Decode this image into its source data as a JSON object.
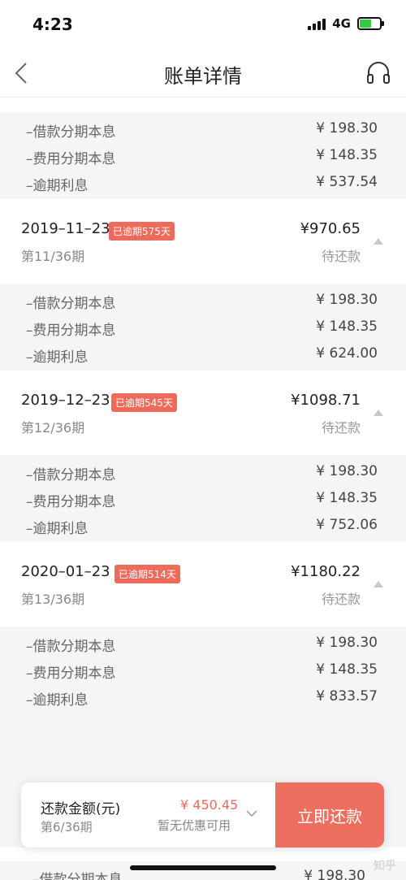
{
  "status_bar": {
    "time": "4:23",
    "network": "4G"
  },
  "nav": {
    "title": "账单详情",
    "back_icon": "chevron-left-icon",
    "service_icon": "headset-icon"
  },
  "first_details": [
    {
      "label": "–借款分期本息",
      "amount": "¥ 198.30"
    },
    {
      "label": "–费用分期本息",
      "amount": "¥ 148.35"
    },
    {
      "label": "–逾期利息",
      "amount": "¥ 537.54"
    }
  ],
  "periods": [
    {
      "date": "2019–11–23",
      "badge": "已逾期575天",
      "number": "第11/36期",
      "amount": "¥970.65",
      "status": "待还款",
      "details": [
        {
          "label": "–借款分期本息",
          "amount": "¥ 198.30"
        },
        {
          "label": "–费用分期本息",
          "amount": "¥ 148.35"
        },
        {
          "label": "–逾期利息",
          "amount": "¥ 624.00"
        }
      ]
    },
    {
      "date": "2019–12–23",
      "badge": "已逾期545天",
      "number": "第12/36期",
      "amount": "¥1098.71",
      "status": "待还款",
      "details": [
        {
          "label": "–借款分期本息",
          "amount": "¥ 198.30"
        },
        {
          "label": "–费用分期本息",
          "amount": "¥ 148.35"
        },
        {
          "label": "–逾期利息",
          "amount": "¥ 752.06"
        }
      ]
    },
    {
      "date": "2020–01–23",
      "badge": "已逾期514天",
      "number": "第13/36期",
      "amount": "¥1180.22",
      "status": "待还款",
      "details": [
        {
          "label": "–借款分期本息",
          "amount": "¥ 198.30"
        },
        {
          "label": "–费用分期本息",
          "amount": "¥ 148.35"
        },
        {
          "label": "–逾期利息",
          "amount": "¥ 833.57"
        }
      ]
    }
  ],
  "bottom_bar": {
    "label": "还款金额(元)",
    "period": "第6/36期",
    "amount": "¥ 450.45",
    "discount": "暂无优惠可用",
    "pay_button": "立即还款"
  },
  "partial_row": {
    "label": "–借款分期本息",
    "amount": "¥ 198.30"
  },
  "watermark": "知乎",
  "colors": {
    "accent": "#ee6f5f",
    "badge": "#ee6a5a",
    "background": "#f5f5f7"
  }
}
